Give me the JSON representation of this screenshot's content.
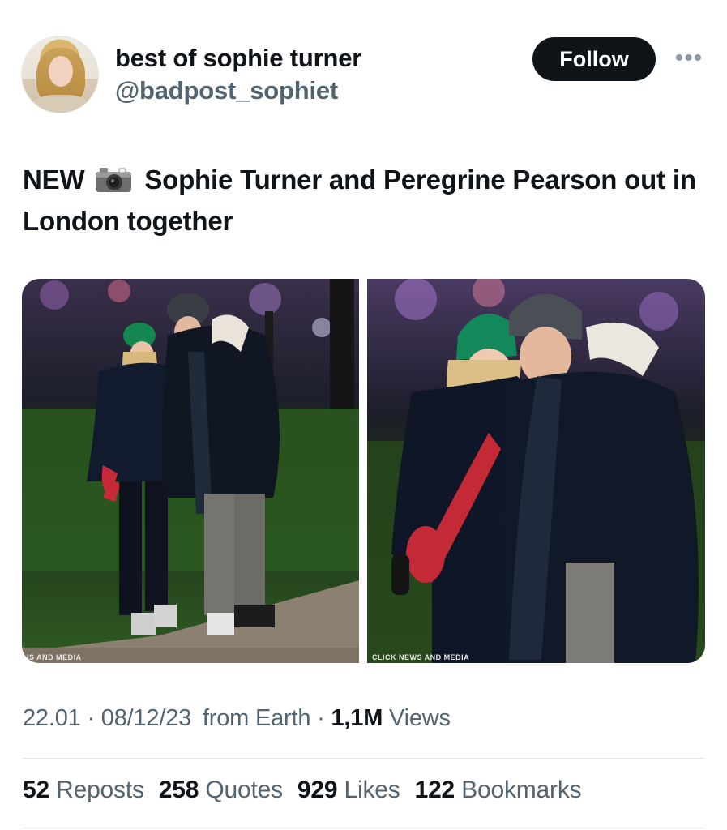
{
  "author": {
    "display_name": "best of sophie turner",
    "handle": "@badpost_sophiet",
    "follow_label": "Follow",
    "more_icon": "more-horizontal-icon"
  },
  "tweet": {
    "text_prefix": "NEW",
    "camera_icon": "camera-with-flash-emoji",
    "text_body": "Sophie Turner and Peregrine Pearson out in London together"
  },
  "media": {
    "photo_left_watermark": "IS AND MEDIA",
    "photo_right_watermark": "CLICK NEWS AND MEDIA"
  },
  "meta": {
    "time": "22.01",
    "date": "08/12/23",
    "source": "from Earth",
    "views_count": "1,1M",
    "views_label": "Views"
  },
  "stats": {
    "reposts_count": "52",
    "reposts_label": "Reposts",
    "quotes_count": "258",
    "quotes_label": "Quotes",
    "likes_count": "929",
    "likes_label": "Likes",
    "bookmarks_count": "122",
    "bookmarks_label": "Bookmarks"
  },
  "colors": {
    "text_primary": "#0f1419",
    "text_secondary": "#536471",
    "follow_bg": "#0f1419",
    "divider": "#e3e7ea"
  }
}
